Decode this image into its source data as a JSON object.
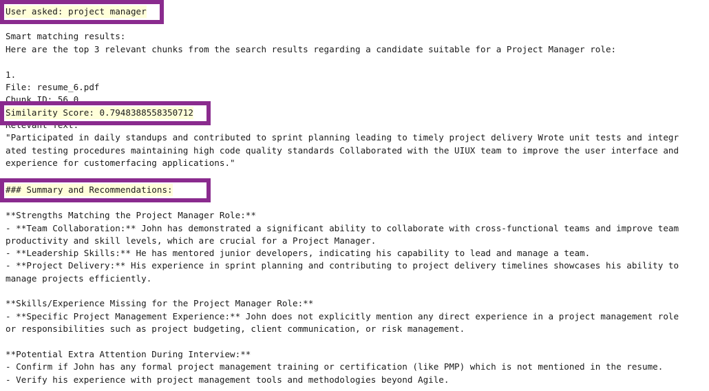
{
  "query": "User asked: project manager",
  "intro": {
    "heading": "Smart matching results:",
    "description": "Here are the top 3 relevant chunks from the search results regarding a candidate suitable for a Project Manager role:"
  },
  "result": {
    "index": "1.",
    "file": "File: resume_6.pdf",
    "chunk_id": "Chunk ID: 56_0",
    "similarity": "Similarity Score: 0.7948388558350712",
    "relevant_label": "Relevant Text:",
    "text_lines": [
      "\"Participated in daily standups and contributed to sprint planning leading to timely project delivery Wrote unit tests and integr",
      "ated testing procedures maintaining high code quality standards Collaborated with the UIUX team to improve the user interface and",
      "experience for customerfacing applications.\""
    ]
  },
  "summary": {
    "heading": "### Summary and Recommendations:",
    "strengths_heading": "**Strengths Matching the Project Manager Role:**",
    "strengths_lines": [
      "- **Team Collaboration:** John has demonstrated a significant ability to collaborate with cross-functional teams and improve team",
      "productivity and skill levels, which are crucial for a Project Manager.",
      "- **Leadership Skills:** He has mentored junior developers, indicating his capability to lead and manage a team.",
      "- **Project Delivery:** His experience in sprint planning and contributing to project delivery timelines showcases his ability to",
      "manage projects efficiently."
    ],
    "missing_heading": "**Skills/Experience Missing for the Project Manager Role:**",
    "missing_lines": [
      "- **Specific Project Management Experience:** John does not explicitly mention any direct experience in a project management role",
      "or responsibilities such as project budgeting, client communication, or risk management."
    ],
    "attention_heading": "**Potential Extra Attention During Interview:**",
    "attention_lines": [
      "- Confirm if John has any formal project management training or certification (like PMP) which is not mentioned in the resume.",
      "- Verify his experience with project management tools and methodologies beyond Agile."
    ]
  },
  "colors": {
    "highlight_border": "#8a2b8e",
    "highlight_fill": "#ffffd9",
    "text": "#1a1a1a"
  }
}
